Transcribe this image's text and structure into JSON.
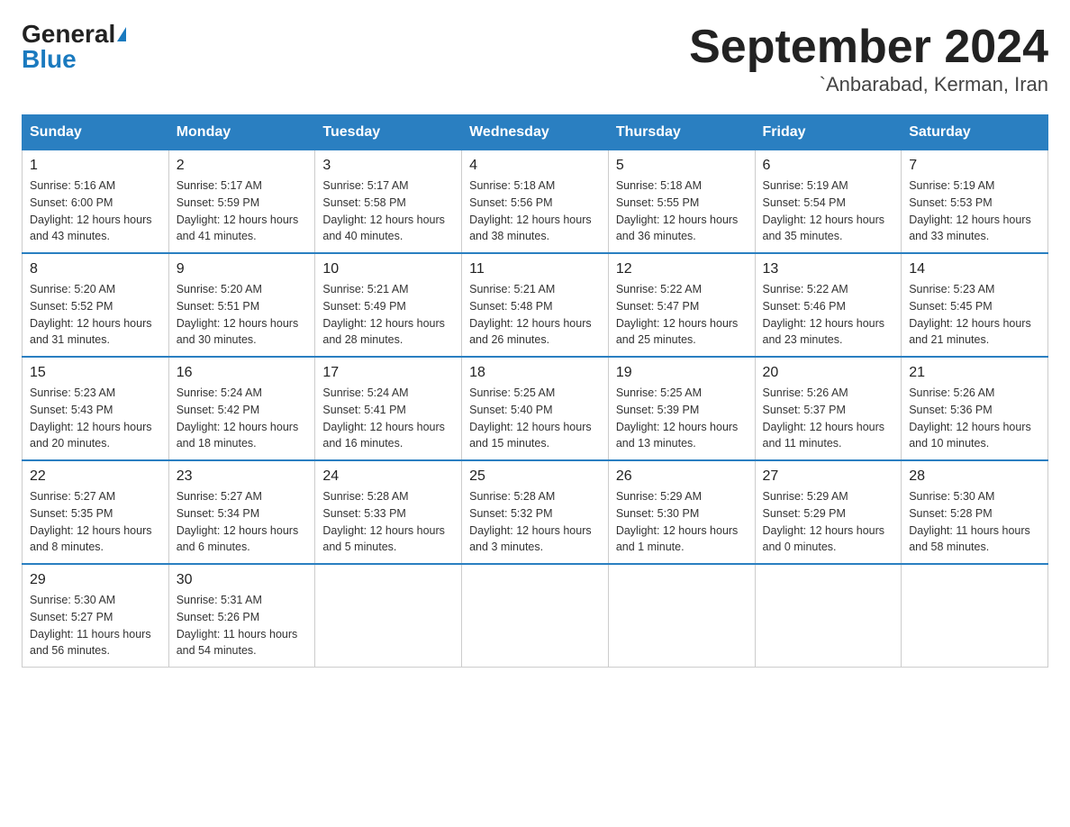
{
  "header": {
    "logo_general": "General",
    "logo_blue": "Blue",
    "month_year": "September 2024",
    "location": "`Anbarabad, Kerman, Iran"
  },
  "weekdays": [
    "Sunday",
    "Monday",
    "Tuesday",
    "Wednesday",
    "Thursday",
    "Friday",
    "Saturday"
  ],
  "weeks": [
    [
      {
        "day": "1",
        "sunrise": "5:16 AM",
        "sunset": "6:00 PM",
        "daylight": "12 hours and 43 minutes."
      },
      {
        "day": "2",
        "sunrise": "5:17 AM",
        "sunset": "5:59 PM",
        "daylight": "12 hours and 41 minutes."
      },
      {
        "day": "3",
        "sunrise": "5:17 AM",
        "sunset": "5:58 PM",
        "daylight": "12 hours and 40 minutes."
      },
      {
        "day": "4",
        "sunrise": "5:18 AM",
        "sunset": "5:56 PM",
        "daylight": "12 hours and 38 minutes."
      },
      {
        "day": "5",
        "sunrise": "5:18 AM",
        "sunset": "5:55 PM",
        "daylight": "12 hours and 36 minutes."
      },
      {
        "day": "6",
        "sunrise": "5:19 AM",
        "sunset": "5:54 PM",
        "daylight": "12 hours and 35 minutes."
      },
      {
        "day": "7",
        "sunrise": "5:19 AM",
        "sunset": "5:53 PM",
        "daylight": "12 hours and 33 minutes."
      }
    ],
    [
      {
        "day": "8",
        "sunrise": "5:20 AM",
        "sunset": "5:52 PM",
        "daylight": "12 hours and 31 minutes."
      },
      {
        "day": "9",
        "sunrise": "5:20 AM",
        "sunset": "5:51 PM",
        "daylight": "12 hours and 30 minutes."
      },
      {
        "day": "10",
        "sunrise": "5:21 AM",
        "sunset": "5:49 PM",
        "daylight": "12 hours and 28 minutes."
      },
      {
        "day": "11",
        "sunrise": "5:21 AM",
        "sunset": "5:48 PM",
        "daylight": "12 hours and 26 minutes."
      },
      {
        "day": "12",
        "sunrise": "5:22 AM",
        "sunset": "5:47 PM",
        "daylight": "12 hours and 25 minutes."
      },
      {
        "day": "13",
        "sunrise": "5:22 AM",
        "sunset": "5:46 PM",
        "daylight": "12 hours and 23 minutes."
      },
      {
        "day": "14",
        "sunrise": "5:23 AM",
        "sunset": "5:45 PM",
        "daylight": "12 hours and 21 minutes."
      }
    ],
    [
      {
        "day": "15",
        "sunrise": "5:23 AM",
        "sunset": "5:43 PM",
        "daylight": "12 hours and 20 minutes."
      },
      {
        "day": "16",
        "sunrise": "5:24 AM",
        "sunset": "5:42 PM",
        "daylight": "12 hours and 18 minutes."
      },
      {
        "day": "17",
        "sunrise": "5:24 AM",
        "sunset": "5:41 PM",
        "daylight": "12 hours and 16 minutes."
      },
      {
        "day": "18",
        "sunrise": "5:25 AM",
        "sunset": "5:40 PM",
        "daylight": "12 hours and 15 minutes."
      },
      {
        "day": "19",
        "sunrise": "5:25 AM",
        "sunset": "5:39 PM",
        "daylight": "12 hours and 13 minutes."
      },
      {
        "day": "20",
        "sunrise": "5:26 AM",
        "sunset": "5:37 PM",
        "daylight": "12 hours and 11 minutes."
      },
      {
        "day": "21",
        "sunrise": "5:26 AM",
        "sunset": "5:36 PM",
        "daylight": "12 hours and 10 minutes."
      }
    ],
    [
      {
        "day": "22",
        "sunrise": "5:27 AM",
        "sunset": "5:35 PM",
        "daylight": "12 hours and 8 minutes."
      },
      {
        "day": "23",
        "sunrise": "5:27 AM",
        "sunset": "5:34 PM",
        "daylight": "12 hours and 6 minutes."
      },
      {
        "day": "24",
        "sunrise": "5:28 AM",
        "sunset": "5:33 PM",
        "daylight": "12 hours and 5 minutes."
      },
      {
        "day": "25",
        "sunrise": "5:28 AM",
        "sunset": "5:32 PM",
        "daylight": "12 hours and 3 minutes."
      },
      {
        "day": "26",
        "sunrise": "5:29 AM",
        "sunset": "5:30 PM",
        "daylight": "12 hours and 1 minute."
      },
      {
        "day": "27",
        "sunrise": "5:29 AM",
        "sunset": "5:29 PM",
        "daylight": "12 hours and 0 minutes."
      },
      {
        "day": "28",
        "sunrise": "5:30 AM",
        "sunset": "5:28 PM",
        "daylight": "11 hours and 58 minutes."
      }
    ],
    [
      {
        "day": "29",
        "sunrise": "5:30 AM",
        "sunset": "5:27 PM",
        "daylight": "11 hours and 56 minutes."
      },
      {
        "day": "30",
        "sunrise": "5:31 AM",
        "sunset": "5:26 PM",
        "daylight": "11 hours and 54 minutes."
      },
      null,
      null,
      null,
      null,
      null
    ]
  ],
  "labels": {
    "sunrise": "Sunrise:",
    "sunset": "Sunset:",
    "daylight": "Daylight:"
  }
}
